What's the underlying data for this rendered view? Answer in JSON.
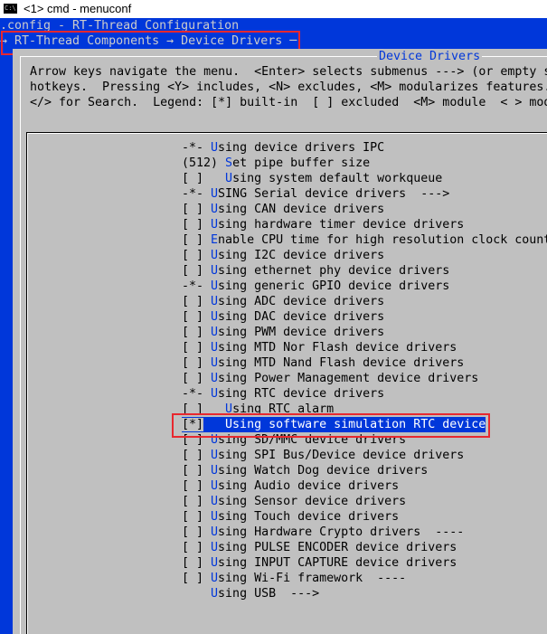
{
  "window": {
    "title": "<1> cmd - menuconf",
    "icon": "cmd-icon"
  },
  "header": {
    "config_title": ".config - RT-Thread Configuration",
    "breadcrumb": "→ RT-Thread Components → Device Drivers ─"
  },
  "dialog": {
    "title": "Device Drivers",
    "help_lines": [
      "Arrow keys navigate the menu.  <Enter> selects submenus ---> (or empty s",
      "hotkeys.  Pressing <Y> includes, <N> excludes, <M> modularizes features.",
      "</> for Search.  Legend: [*] built-in  [ ] excluded  <M> module  < > mod"
    ]
  },
  "menu": {
    "items": [
      {
        "prefix": "-*- ",
        "hotkey": "U",
        "rest": "sing device drivers IPC"
      },
      {
        "prefix": "(512) ",
        "hotkey": "S",
        "rest": "et pipe buffer size"
      },
      {
        "prefix": "[ ]   ",
        "hotkey": "U",
        "rest": "sing system default workqueue"
      },
      {
        "prefix": "-*- ",
        "hotkey": "U",
        "rest": "SING Serial device drivers  --->"
      },
      {
        "prefix": "[ ] ",
        "hotkey": "U",
        "rest": "sing CAN device drivers"
      },
      {
        "prefix": "[ ] ",
        "hotkey": "U",
        "rest": "sing hardware timer device drivers"
      },
      {
        "prefix": "[ ] ",
        "hotkey": "E",
        "rest": "nable CPU time for high resolution clock counter"
      },
      {
        "prefix": "[ ] ",
        "hotkey": "U",
        "rest": "sing I2C device drivers"
      },
      {
        "prefix": "[ ] ",
        "hotkey": "U",
        "rest": "sing ethernet phy device drivers"
      },
      {
        "prefix": "-*- ",
        "hotkey": "U",
        "rest": "sing generic GPIO device drivers"
      },
      {
        "prefix": "[ ] ",
        "hotkey": "U",
        "rest": "sing ADC device drivers"
      },
      {
        "prefix": "[ ] ",
        "hotkey": "U",
        "rest": "sing DAC device drivers"
      },
      {
        "prefix": "[ ] ",
        "hotkey": "U",
        "rest": "sing PWM device drivers"
      },
      {
        "prefix": "[ ] ",
        "hotkey": "U",
        "rest": "sing MTD Nor Flash device drivers"
      },
      {
        "prefix": "[ ] ",
        "hotkey": "U",
        "rest": "sing MTD Nand Flash device drivers"
      },
      {
        "prefix": "[ ] ",
        "hotkey": "U",
        "rest": "sing Power Management device drivers"
      },
      {
        "prefix": "-*- ",
        "hotkey": "U",
        "rest": "sing RTC device drivers"
      },
      {
        "prefix": "[ ]   ",
        "hotkey": "U",
        "rest": "sing RTC alarm"
      },
      {
        "prefix": "[*]",
        "hotkey": "",
        "rest": "   Using software simulation RTC device",
        "selected": true
      },
      {
        "prefix": "[ ] ",
        "hotkey": "U",
        "rest": "sing SD/MMC device drivers"
      },
      {
        "prefix": "[ ] ",
        "hotkey": "U",
        "rest": "sing SPI Bus/Device device drivers"
      },
      {
        "prefix": "[ ] ",
        "hotkey": "U",
        "rest": "sing Watch Dog device drivers"
      },
      {
        "prefix": "[ ] ",
        "hotkey": "U",
        "rest": "sing Audio device drivers"
      },
      {
        "prefix": "[ ] ",
        "hotkey": "U",
        "rest": "sing Sensor device drivers"
      },
      {
        "prefix": "[ ] ",
        "hotkey": "U",
        "rest": "sing Touch device drivers"
      },
      {
        "prefix": "[ ] ",
        "hotkey": "U",
        "rest": "sing Hardware Crypto drivers  ----"
      },
      {
        "prefix": "[ ] ",
        "hotkey": "U",
        "rest": "sing PULSE ENCODER device drivers"
      },
      {
        "prefix": "[ ] ",
        "hotkey": "U",
        "rest": "sing INPUT CAPTURE device drivers"
      },
      {
        "prefix": "[ ] ",
        "hotkey": "U",
        "rest": "sing Wi-Fi framework  ----"
      },
      {
        "prefix": "    ",
        "hotkey": "U",
        "rest": "sing USB  --->"
      }
    ]
  },
  "colors": {
    "terminal_blue": "#0037da",
    "dialog_gray": "#c0c0c0",
    "highlight_box": "#e8282f"
  }
}
